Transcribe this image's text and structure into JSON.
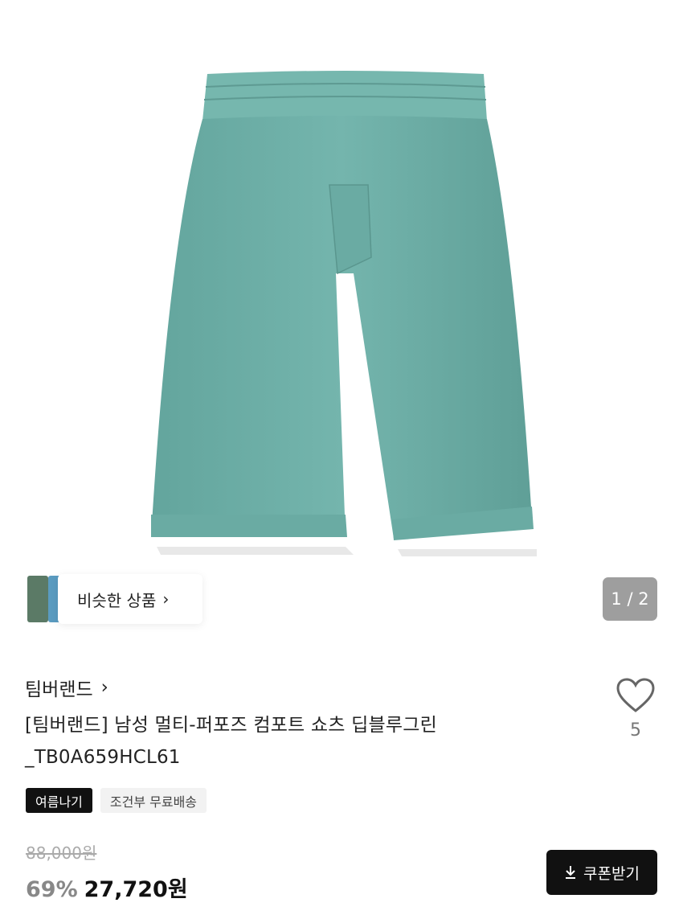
{
  "product": {
    "image_alt": "teal shorts product photo",
    "color": "#6fb0a8"
  },
  "similar": {
    "label": "비슷한 상품",
    "chevron": "›"
  },
  "pager": {
    "text": "1 / 2"
  },
  "brand": {
    "name": "팀버랜드",
    "chevron": "›"
  },
  "title": {
    "line1": "[팀버랜드] 남성 멀티-퍼포즈 컴포트 쇼츠 딥블루그린",
    "line2": "_TB0A659HCL61"
  },
  "wishlist": {
    "icon": "heart-icon",
    "count": "5"
  },
  "tags": [
    "여름나기",
    "조건부 무료배송"
  ],
  "price": {
    "original": "88,000원",
    "discount": "69%",
    "sale": "27,720원"
  },
  "coupon": {
    "label": "쿠폰받기",
    "icon": "download-icon"
  }
}
